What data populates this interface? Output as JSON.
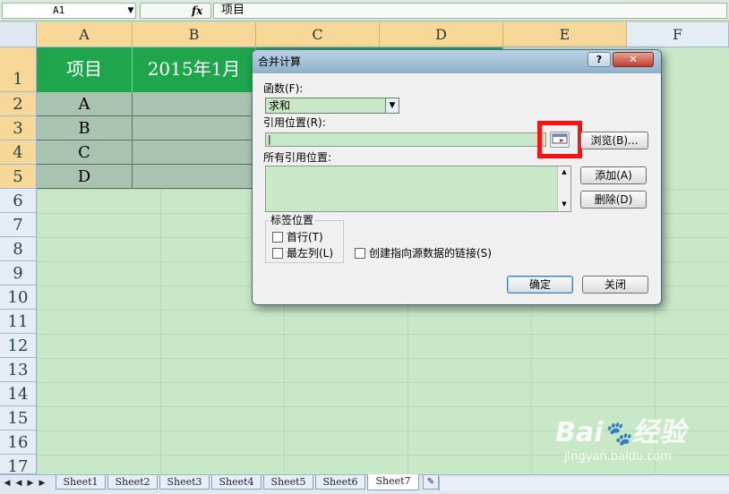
{
  "formula_bar": {
    "name_box": "A1",
    "formula": "项目"
  },
  "columns": [
    "A",
    "B",
    "C",
    "D",
    "E",
    "F"
  ],
  "rows": [
    "1",
    "2",
    "3",
    "4",
    "5",
    "6",
    "7",
    "8",
    "9",
    "10",
    "11",
    "12",
    "13",
    "14",
    "15",
    "16",
    "17"
  ],
  "cells": {
    "a1": "项目",
    "b1": "2015年1月",
    "a_values": [
      "A",
      "B",
      "C",
      "D"
    ]
  },
  "sheet_tabs": [
    "Sheet1",
    "Sheet2",
    "Sheet3",
    "Sheet4",
    "Sheet5",
    "Sheet6",
    "Sheet7"
  ],
  "active_sheet": "Sheet7",
  "dialog": {
    "title": "合并计算",
    "help_label": "?",
    "close_label": "✕",
    "function_label": "函数(F):",
    "function_value": "求和",
    "reference_label": "引用位置(R):",
    "reference_value": "|",
    "browse_button": "浏览(B)...",
    "all_references_label": "所有引用位置:",
    "add_button": "添加(A)",
    "delete_button": "删除(D)",
    "label_position_group": "标签位置",
    "first_row": "首行(T)",
    "left_column": "最左列(L)",
    "create_links": "创建指向源数据的链接(S)",
    "ok_button": "确定",
    "close_button": "关闭"
  },
  "watermark": "Bai 经验 jingyan.baidu.com",
  "colors": {
    "header_green": "#1fa64c",
    "data_cell": "#a8c4b0",
    "sheet_bg": "#c8e8c8",
    "highlight_red": "#ff1010"
  }
}
